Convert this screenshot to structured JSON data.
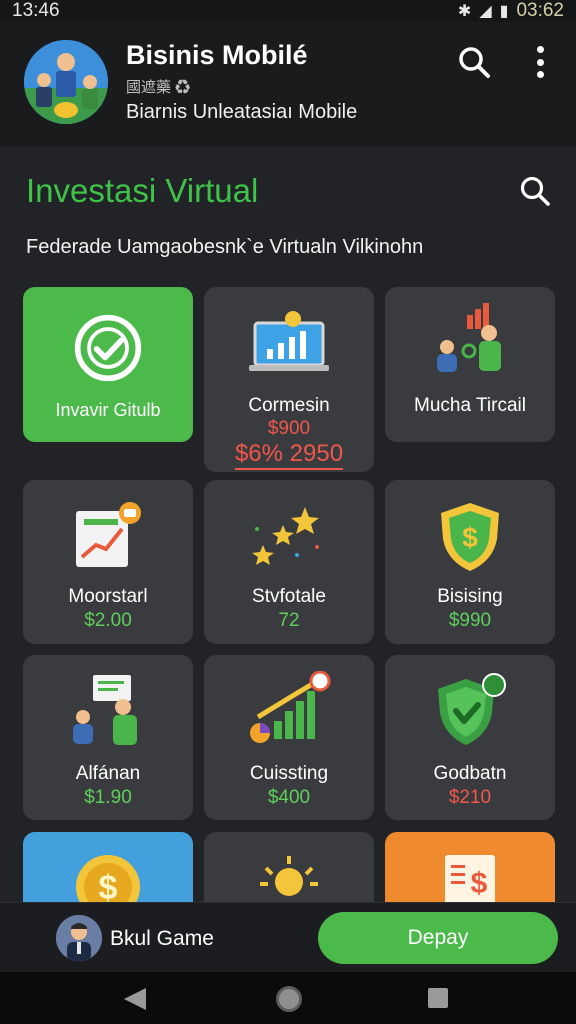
{
  "status_bar": {
    "time": "13:46",
    "clock_right": "03:62",
    "icons": [
      "bluetooth-icon",
      "signal-icon",
      "battery-icon"
    ]
  },
  "header": {
    "title": "Bisinis Mobilé",
    "subtitle_small": "國遮藥 ♻",
    "subtitle": "Biarnis Unleatasiaı Mobile",
    "icons": [
      "search-icon",
      "more-vertical-icon"
    ]
  },
  "section": {
    "title": "Investasi Virtual",
    "description": "Federade Uamgaobesnk`e  Virtualn Vilkinohn"
  },
  "cards": [
    {
      "name": "Invavir Gitulb",
      "icon": "check-circle-icon",
      "style": "green"
    },
    {
      "name": "Cormesin",
      "price": "$900",
      "promo": "$6% 2950",
      "icon": "laptop-chart-icon"
    },
    {
      "name": "Mucha Tircail",
      "icon": "business-meeting-icon"
    },
    {
      "name": "Moorstarl",
      "price": "$2.00",
      "icon": "growth-document-icon"
    },
    {
      "name": "Stvfotale",
      "price": "72",
      "icon": "stars-icon"
    },
    {
      "name": "Bisising",
      "price": "$990",
      "icon": "dollar-shield-icon"
    },
    {
      "name": "Alfánan",
      "price": "$1.90",
      "icon": "people-discussion-icon"
    },
    {
      "name": "Cuissting",
      "price": "$400",
      "icon": "growth-chart-icon"
    },
    {
      "name": "Godbatn",
      "price": "$210",
      "icon": "green-shield-icon"
    },
    {
      "name": "",
      "icon": "gold-coin-icon",
      "style": "blue"
    },
    {
      "name": "",
      "icon": "sun-icon"
    },
    {
      "name": "",
      "icon": "dollar-document-icon",
      "style": "orange"
    }
  ],
  "colors": {
    "accent_green": "#4cba4b",
    "price_green": "#5ecf5b",
    "price_red": "#f0574b",
    "card_bg": "#3a3b3e",
    "page_bg": "#222326"
  },
  "bottom_bar": {
    "label": "Bkul Game",
    "button": "Depay"
  },
  "nav_bar": {
    "icons": [
      "back-icon",
      "home-icon",
      "recents-icon"
    ]
  }
}
